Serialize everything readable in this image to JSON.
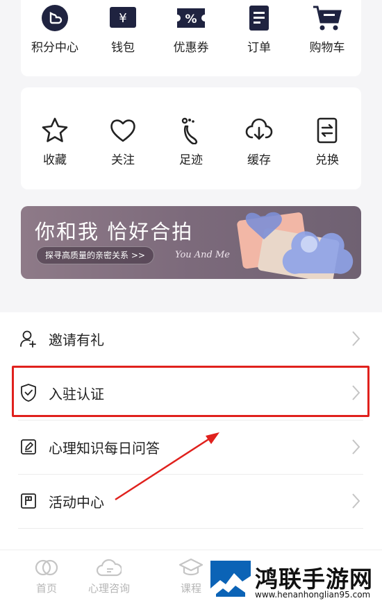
{
  "quick_actions": [
    {
      "label": "积分中心",
      "icon": "points-center-icon"
    },
    {
      "label": "钱包",
      "icon": "wallet-icon"
    },
    {
      "label": "优惠券",
      "icon": "coupon-icon"
    },
    {
      "label": "订单",
      "icon": "order-icon"
    },
    {
      "label": "购物车",
      "icon": "cart-icon"
    }
  ],
  "tools": [
    {
      "label": "收藏",
      "icon": "star-icon"
    },
    {
      "label": "关注",
      "icon": "heart-icon"
    },
    {
      "label": "足迹",
      "icon": "footprint-icon"
    },
    {
      "label": "缓存",
      "icon": "download-cloud-icon"
    },
    {
      "label": "兑换",
      "icon": "exchange-icon"
    }
  ],
  "banner": {
    "title": "你和我 恰好合拍",
    "pill": "探寻高质量的亲密关系 >>",
    "subtitle_en": "You And Me"
  },
  "menu": [
    {
      "label": "邀请有礼",
      "icon": "invite-user-icon"
    },
    {
      "label": "入驻认证",
      "icon": "shield-check-icon"
    },
    {
      "label": "心理知识每日问答",
      "icon": "edit-square-icon"
    },
    {
      "label": "活动中心",
      "icon": "flag-icon"
    }
  ],
  "tabs": [
    {
      "label": "首页",
      "icon": "home-icon"
    },
    {
      "label": "心理咨询",
      "icon": "consult-icon"
    },
    {
      "label": "课程",
      "icon": "course-icon"
    }
  ],
  "watermark": {
    "title": "鸿联手游网",
    "url": "www.henanhonglian95.com"
  },
  "colors": {
    "icon_dark": "#1f2340",
    "highlight_red": "#e0211d",
    "tab_inactive": "#b5b5b5"
  }
}
